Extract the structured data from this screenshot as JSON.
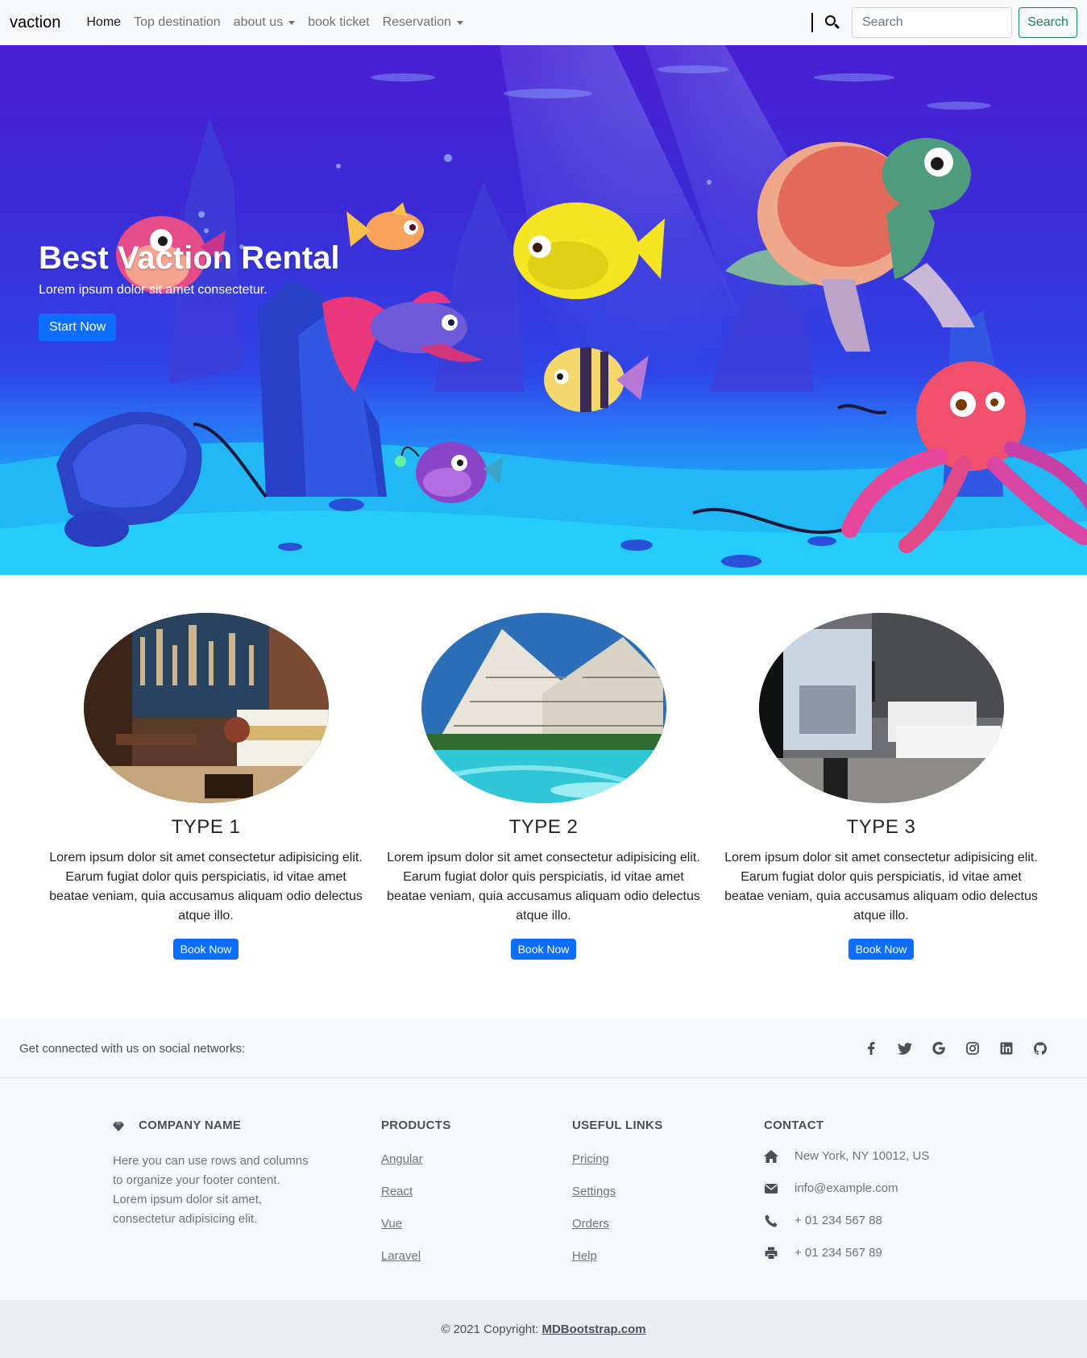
{
  "navbar": {
    "brand": "vaction",
    "links": [
      {
        "label": "Home",
        "active": true,
        "dropdown": false
      },
      {
        "label": "Top destination",
        "active": false,
        "dropdown": false
      },
      {
        "label": "about us",
        "active": false,
        "dropdown": true
      },
      {
        "label": "book ticket",
        "active": false,
        "dropdown": false
      },
      {
        "label": "Reservation",
        "active": false,
        "dropdown": true
      }
    ],
    "search_placeholder": "Search",
    "search_button": "Search"
  },
  "hero": {
    "title": "Best Vaction Rental",
    "subtitle": "Lorem ipsum dolor sit amet consectetur.",
    "button": "Start Now"
  },
  "cards": [
    {
      "title": "TYPE 1",
      "text": "Lorem ipsum dolor sit amet consectetur adipisicing elit. Earum fugiat dolor quis perspiciatis, id vitae amet beatae veniam, quia accusamus aliquam odio delectus atque illo.",
      "button": "Book Now",
      "image": "hotel-room-city-view"
    },
    {
      "title": "TYPE 2",
      "text": "Lorem ipsum dolor sit amet consectetur adipisicing elit. Earum fugiat dolor quis perspiciatis, id vitae amet beatae veniam, quia accusamus aliquam odio delectus atque illo.",
      "button": "Book Now",
      "image": "hotel-pool"
    },
    {
      "title": "TYPE 3",
      "text": "Lorem ipsum dolor sit amet consectetur adipisicing elit. Earum fugiat dolor quis perspiciatis, id vitae amet beatae veniam, quia accusamus aliquam odio delectus atque illo.",
      "button": "Book Now",
      "image": "modern-bedroom"
    }
  ],
  "social": {
    "text": "Get connected with us on social networks:",
    "icons": [
      "facebook-icon",
      "twitter-icon",
      "google-icon",
      "instagram-icon",
      "linkedin-icon",
      "github-icon"
    ]
  },
  "footer": {
    "company": {
      "title": "Company name",
      "description": "Here you can use rows and columns to organize your footer content. Lorem ipsum dolor sit amet, consectetur adipisicing elit."
    },
    "products": {
      "title": "Products",
      "links": [
        "Angular",
        "React",
        "Vue",
        "Laravel"
      ]
    },
    "useful_links": {
      "title": "Useful links",
      "links": [
        "Pricing",
        "Settings",
        "Orders",
        "Help"
      ]
    },
    "contact": {
      "title": "Contact",
      "address": "New York, NY 10012, US",
      "email": "info@example.com",
      "phone": "+ 01 234 567 88",
      "fax": "+ 01 234 567 89"
    }
  },
  "copyright": {
    "text": "© 2021 Copyright:",
    "link": "MDBootstrap.com"
  },
  "colors": {
    "primary": "#0d6efd",
    "success": "#198754",
    "light": "#f8f9fa"
  }
}
